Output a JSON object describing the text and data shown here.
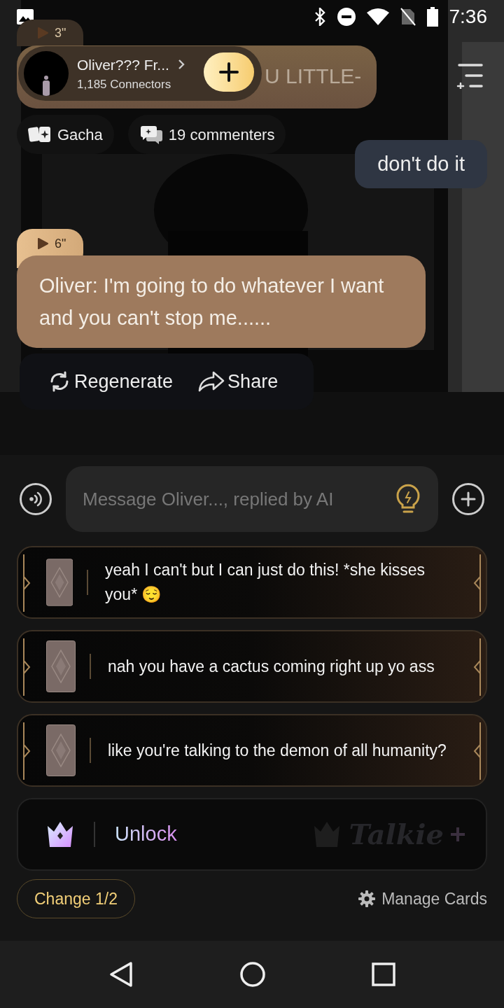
{
  "status_bar": {
    "time": "7:36"
  },
  "earlier_message": {
    "duration": "3\"",
    "visible_text": "U LITTLE-"
  },
  "header": {
    "name": "Oliver??? Fr...",
    "followers": "1,185 Connectors"
  },
  "chips": [
    {
      "kind": "gacha",
      "label": "Gacha"
    },
    {
      "kind": "comments",
      "label": "19 commenters"
    }
  ],
  "messages": [
    {
      "kind": "user",
      "text": "don't do it"
    },
    {
      "kind": "character",
      "duration": "6\"",
      "text": "Oliver: I'm going to do whatever I want and you can't stop me......"
    }
  ],
  "actions": [
    {
      "kind": "regenerate",
      "label": "Regenerate"
    },
    {
      "kind": "share",
      "label": "Share"
    }
  ],
  "composer": {
    "placeholder": "Message Oliver..., replied by AI"
  },
  "reply_cards": [
    {
      "text": "yeah I can't but I can just do this! *she kisses you* 😌"
    },
    {
      "text": "nah you have a cactus coming right up yo ass"
    },
    {
      "text": "like you're talking to the demon of all humanity?"
    }
  ],
  "unlock": {
    "label": "Unlock",
    "brand": "Talkie"
  },
  "footer": {
    "change": "Change 1/2",
    "manage": "Manage Cards"
  }
}
